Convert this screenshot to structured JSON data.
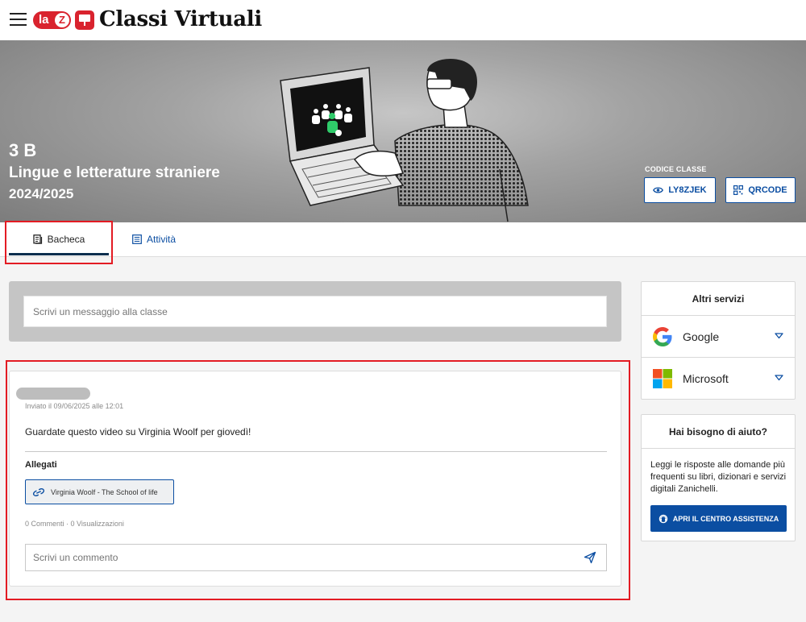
{
  "header": {
    "brand_short": "la",
    "brand_z": "Z",
    "app_title": "Classi Virtuali"
  },
  "hero": {
    "class_name": "3 B",
    "subject": "Lingue e letterature straniere",
    "year": "2024/2025",
    "code_label": "CODICE CLASSE",
    "code_value": "LY8ZJEK",
    "qr_label": "QRCODE"
  },
  "tabs": [
    {
      "label": "Bacheca",
      "active": true
    },
    {
      "label": "Attività",
      "active": false
    }
  ],
  "composer": {
    "placeholder": "Scrivi un messaggio alla classe"
  },
  "post": {
    "date": "Inviato il 09/06/2025 alle 12:01",
    "body": "Guardate questo video su Virginia Woolf per giovedì!",
    "attachments_title": "Allegati",
    "attachment_label": "Virginia Woolf - The School of life",
    "stats": "0 Commenti · 0 Visualizzazioni",
    "comment_placeholder": "Scrivi un commento"
  },
  "services": {
    "title": "Altri servizi",
    "items": [
      {
        "label": "Google",
        "icon": "google-icon"
      },
      {
        "label": "Microsoft",
        "icon": "microsoft-icon"
      }
    ]
  },
  "help": {
    "title": "Hai bisogno di aiuto?",
    "text": "Leggi le risposte alle domande più frequenti su libri, dizionari e servizi digitali Zanichelli.",
    "button_label": "APRI IL CENTRO ASSISTENZA"
  },
  "colors": {
    "brand_red": "#d9232e",
    "primary_blue": "#0b4ea2",
    "highlight_red": "#e31b23"
  }
}
